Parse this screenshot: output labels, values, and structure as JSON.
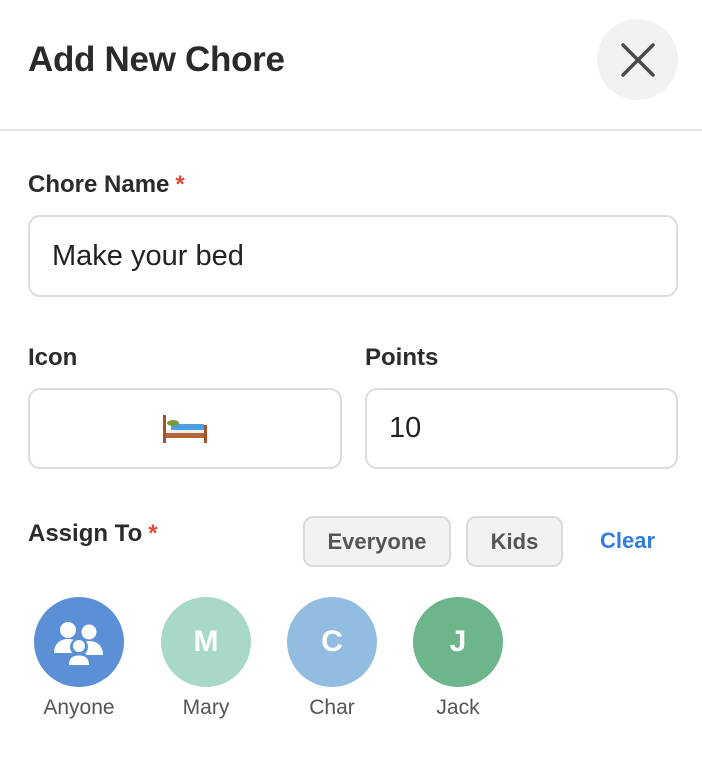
{
  "header": {
    "title": "Add New Chore",
    "close_icon": "close-x-icon"
  },
  "form": {
    "chore_name": {
      "label": "Chore Name",
      "required_marker": "*",
      "value": "Make your bed"
    },
    "icon": {
      "label": "Icon",
      "value": "🛏️",
      "icon_name": "bed-icon"
    },
    "points": {
      "label": "Points",
      "value": "10"
    },
    "assign_to": {
      "label": "Assign To",
      "required_marker": "*",
      "quick_buttons": [
        "Everyone",
        "Kids"
      ],
      "clear_label": "Clear",
      "people": [
        {
          "name": "Anyone",
          "initial": "",
          "icon": "group-icon",
          "color": "#5b8fd6"
        },
        {
          "name": "Mary",
          "initial": "M",
          "color": "#a8d8c8"
        },
        {
          "name": "Char",
          "initial": "C",
          "color": "#93bde0"
        },
        {
          "name": "Jack",
          "initial": "J",
          "color": "#6db58a"
        }
      ]
    }
  },
  "colors": {
    "required": "#e0483a",
    "link": "#2f7de1",
    "border": "#dcdcdc"
  }
}
